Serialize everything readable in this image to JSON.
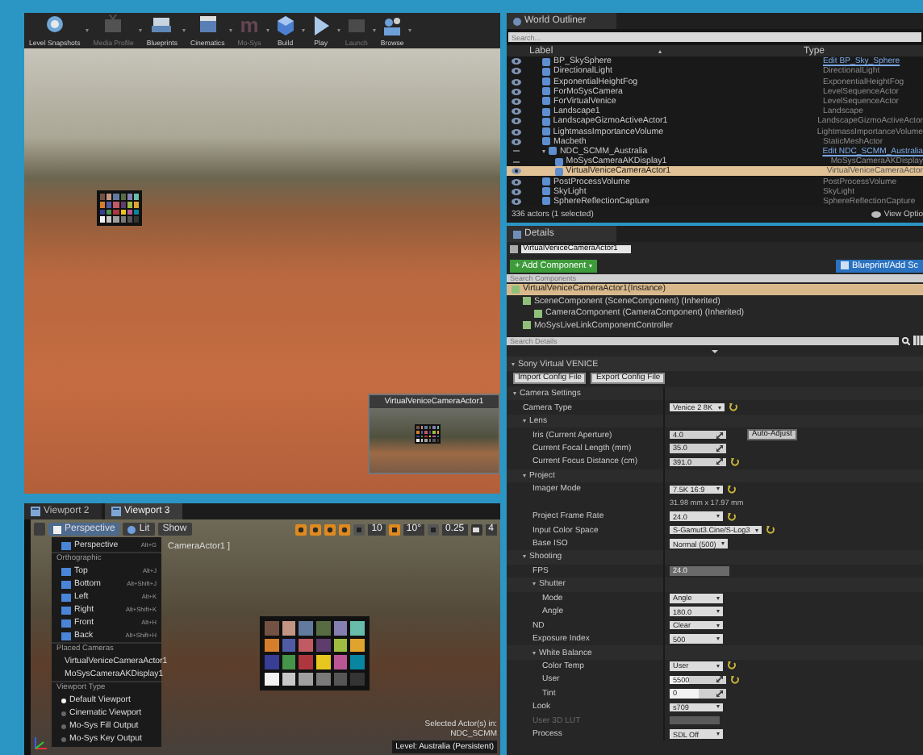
{
  "toolbar": [
    {
      "label": "Level Snapshots",
      "disabled": false
    },
    {
      "label": "Media Profile",
      "disabled": true
    },
    {
      "label": "Blueprints",
      "disabled": false
    },
    {
      "label": "Cinematics",
      "disabled": false
    },
    {
      "label": "Mo-Sys",
      "disabled": true,
      "logo_text": "m"
    },
    {
      "label": "Build",
      "disabled": false
    },
    {
      "label": "Play",
      "disabled": false
    },
    {
      "label": "Launch",
      "disabled": true
    },
    {
      "label": "Browse",
      "disabled": false
    }
  ],
  "top_viewport": {
    "preview": {
      "title": "VirtualVeniceCameraActor1"
    }
  },
  "viewport_tabs": [
    {
      "label": "Viewport 2",
      "selected": false
    },
    {
      "label": "Viewport 3",
      "selected": true
    }
  ],
  "bottom_viewport": {
    "view_button": "Perspective",
    "lit_button": "Lit",
    "show_button": "Show",
    "snaps": [
      {
        "value": "10",
        "on": false
      },
      {
        "value": "10°",
        "on": true
      },
      {
        "value": "0.25",
        "on": false
      }
    ],
    "camera_speed": "4",
    "actor_label": "CameraActor1 ]",
    "menu": [
      {
        "kind": "view",
        "label": "Perspective",
        "shortcut": "Alt+G"
      },
      {
        "kind": "header",
        "label": "Orthographic"
      },
      {
        "kind": "view",
        "label": "Top",
        "shortcut": "Alt+J"
      },
      {
        "kind": "view",
        "label": "Bottom",
        "shortcut": "Alt+Shift+J"
      },
      {
        "kind": "view",
        "label": "Left",
        "shortcut": "Alt+K"
      },
      {
        "kind": "view",
        "label": "Right",
        "shortcut": "Alt+Shift+K"
      },
      {
        "kind": "view",
        "label": "Front",
        "shortcut": "Alt+H"
      },
      {
        "kind": "view",
        "label": "Back",
        "shortcut": "Alt+Shift+H"
      },
      {
        "kind": "header",
        "label": "Placed Cameras"
      },
      {
        "kind": "camera",
        "label": "VirtualVeniceCameraActor1"
      },
      {
        "kind": "camera",
        "label": "MoSysCameraAKDisplay1"
      },
      {
        "kind": "header",
        "label": "Viewport Type"
      },
      {
        "kind": "option",
        "label": "Default Viewport",
        "selected": true
      },
      {
        "kind": "option",
        "label": "Cinematic Viewport",
        "selected": false
      },
      {
        "kind": "option",
        "label": "Mo-Sys Fill Output",
        "selected": false
      },
      {
        "kind": "option",
        "label": "Mo-Sys Key Output",
        "selected": false
      }
    ],
    "selected_info": "Selected Actor(s) in:",
    "selected_level": "NDC_SCMM",
    "level": "Level:  Australia (Persistent)"
  },
  "outliner": {
    "title": "World Outliner",
    "search": {
      "placeholder": "Search..."
    },
    "columns": [
      "Label",
      "Type"
    ],
    "rows": [
      {
        "label": "BP_SkySphere",
        "type": "Edit BP_Sky_Sphere",
        "link": true,
        "visible": true,
        "selected": false
      },
      {
        "label": "DirectionalLight",
        "type": "DirectionalLight",
        "visible": true,
        "selected": false
      },
      {
        "label": "ExponentialHeightFog",
        "type": "ExponentialHeightFog",
        "visible": true,
        "selected": false
      },
      {
        "label": "ForMoSysCamera",
        "type": "LevelSequenceActor",
        "visible": true,
        "selected": false
      },
      {
        "label": "ForVirtualVenice",
        "type": "LevelSequenceActor",
        "visible": true,
        "selected": false
      },
      {
        "label": "Landscape1",
        "type": "Landscape",
        "visible": true,
        "selected": false
      },
      {
        "label": "LandscapeGizmoActiveActor1",
        "type": "LandscapeGizmoActiveActor",
        "visible": true,
        "selected": false
      },
      {
        "label": "LightmassImportanceVolume",
        "type": "LightmassImportanceVolume",
        "visible": true,
        "selected": false
      },
      {
        "label": "Macbeth",
        "type": "StaticMeshActor",
        "visible": true,
        "selected": false
      },
      {
        "label": "NDC_SCMM_Australia",
        "type": "Edit NDC_SCMM_Australia",
        "link": true,
        "visible": false,
        "selected": false,
        "expanded": true,
        "children": [
          {
            "label": "MoSysCameraAKDisplay1",
            "type": "MoSysCameraAKDisplay",
            "visible": false,
            "selected": false
          },
          {
            "label": "VirtualVeniceCameraActor1",
            "type": "VirtualVeniceCameraActor",
            "visible": true,
            "selected": true
          }
        ]
      },
      {
        "label": "PostProcessVolume",
        "type": "PostProcessVolume",
        "visible": true,
        "selected": false
      },
      {
        "label": "SkyLight",
        "type": "SkyLight",
        "visible": true,
        "selected": false
      },
      {
        "label": "SphereReflectionCapture",
        "type": "SphereReflectionCapture",
        "visible": true,
        "selected": false
      }
    ],
    "status": "336 actors (1 selected)",
    "view_options": "View Optio"
  },
  "details": {
    "title": "Details",
    "name": "VirtualVeniceCameraActor1",
    "add_component": "+ Add Component",
    "blueprint": "Blueprint/Add Sc",
    "component_search": {
      "placeholder": "Search Components"
    },
    "components": [
      {
        "label": "VirtualVeniceCameraActor1(Instance)",
        "selected": true
      },
      {
        "label": "SceneComponent (SceneComponent) (Inherited)",
        "selected": false,
        "children": [
          {
            "label": "CameraComponent (CameraComponent) (Inherited)",
            "selected": false
          }
        ]
      },
      {
        "label": "MoSysLiveLinkComponentController",
        "selected": false
      }
    ],
    "details_search": {
      "placeholder": "Search Details"
    },
    "section": "Sony Virtual VENICE",
    "buttons": [
      "Import Config File",
      "Export Config File"
    ],
    "properties": [
      {
        "kind": "category",
        "label": "Camera Settings",
        "expanded": true,
        "children": [
          {
            "kind": "combo",
            "label": "Camera Type",
            "value": "Venice 2 8K",
            "reset": true
          },
          {
            "kind": "category",
            "label": "Lens",
            "expanded": true,
            "children": [
              {
                "kind": "number",
                "label": "Iris (Current Aperture)",
                "value": "4.0",
                "button": "Auto-Adjust"
              },
              {
                "kind": "number",
                "label": "Current Focal Length (mm)",
                "value": "35.0"
              },
              {
                "kind": "number",
                "label": "Current Focus Distance (cm)",
                "value": "391.0",
                "reset": true
              }
            ]
          },
          {
            "kind": "category",
            "label": "Project",
            "expanded": true,
            "children": [
              {
                "kind": "combo",
                "label": "Imager Mode",
                "value": "7.5K 16:9",
                "reset": true
              },
              {
                "kind": "note",
                "value": "31.98 mm x 17.97 mm"
              },
              {
                "kind": "combo",
                "label": "Project Frame Rate",
                "value": "24.0",
                "reset": true
              },
              {
                "kind": "combo",
                "label": "Input Color Space",
                "value": "S-Gamut3.Cine/S-Log3",
                "reset": true
              },
              {
                "kind": "combo",
                "label": "Base ISO",
                "value": "Normal (500)"
              }
            ]
          },
          {
            "kind": "category",
            "label": "Shooting",
            "expanded": true,
            "children": [
              {
                "kind": "readonly",
                "label": "FPS",
                "value": "24.0"
              },
              {
                "kind": "category",
                "label": "Shutter",
                "expanded": true,
                "children": [
                  {
                    "kind": "combo",
                    "label": "Mode",
                    "value": "Angle"
                  },
                  {
                    "kind": "combo",
                    "label": "Angle",
                    "value": "180.0"
                  }
                ]
              },
              {
                "kind": "combo",
                "label": "ND",
                "value": "Clear"
              },
              {
                "kind": "combo",
                "label": "Exposure Index",
                "value": "500"
              },
              {
                "kind": "category",
                "label": "White Balance",
                "expanded": true,
                "children": [
                  {
                    "kind": "combo",
                    "label": "Color Temp",
                    "value": "User",
                    "reset": true
                  },
                  {
                    "kind": "number",
                    "label": "User",
                    "value": "5500",
                    "level": 0.35,
                    "reset": true
                  },
                  {
                    "kind": "number",
                    "label": "Tint",
                    "value": "0",
                    "level": 0.5
                  }
                ]
              },
              {
                "kind": "combo",
                "label": "Look",
                "value": "s709"
              },
              {
                "kind": "asset",
                "label": "User 3D LUT",
                "disabled": true
              },
              {
                "kind": "combo",
                "label": "Process",
                "value": "SDL Off"
              }
            ]
          }
        ]
      }
    ]
  }
}
